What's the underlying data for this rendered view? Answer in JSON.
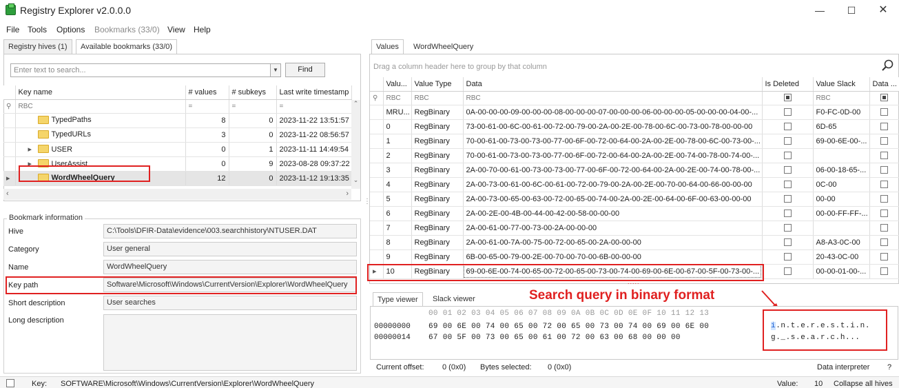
{
  "window": {
    "title": "Registry Explorer v2.0.0.0"
  },
  "menu": [
    "File",
    "Tools",
    "Options",
    "Bookmarks (33/0)",
    "View",
    "Help"
  ],
  "left_tabs": [
    "Registry hives (1)",
    "Available bookmarks (33/0)"
  ],
  "search": {
    "placeholder": "Enter text to search...",
    "find_label": "Find"
  },
  "keys_table": {
    "headers": [
      "Key name",
      "# values",
      "# subkeys",
      "Last write timestamp"
    ],
    "filter_icons": [
      "RBC",
      "=",
      "=",
      "="
    ],
    "rows": [
      {
        "name": "TypedPaths",
        "values": "8",
        "subkeys": "0",
        "ts": "2023-11-22 13:51:57",
        "expand": ""
      },
      {
        "name": "TypedURLs",
        "values": "3",
        "subkeys": "0",
        "ts": "2023-11-22 08:56:57",
        "expand": ""
      },
      {
        "name": "USER",
        "values": "0",
        "subkeys": "1",
        "ts": "2023-11-11 14:49:54",
        "expand": "▸"
      },
      {
        "name": "UserAssist",
        "values": "0",
        "subkeys": "9",
        "ts": "2023-08-28 09:37:22",
        "expand": "▸"
      },
      {
        "name": "WordWheelQuery",
        "values": "12",
        "subkeys": "0",
        "ts": "2023-11-12 19:13:35",
        "expand": ""
      }
    ]
  },
  "bookmark_info": {
    "title": "Bookmark information",
    "hive_label": "Hive",
    "hive": "C:\\Tools\\DFIR-Data\\evidence\\003.searchhistory\\NTUSER.DAT",
    "category_label": "Category",
    "category": "User general",
    "name_label": "Name",
    "name": "WordWheelQuery",
    "keypath_label": "Key path",
    "keypath": "Software\\Microsoft\\Windows\\CurrentVersion\\Explorer\\WordWheelQuery",
    "shortdesc_label": "Short description",
    "shortdesc": "User searches",
    "longdesc_label": "Long description"
  },
  "right_tabs": [
    "Values",
    "WordWheelQuery"
  ],
  "group_hint": "Drag a column header here to group by that column",
  "values_table": {
    "headers": [
      "Valu...",
      "Value Type",
      "Data",
      "Is Deleted",
      "Value Slack",
      "Data ..."
    ],
    "rows": [
      {
        "n": "MRU...",
        "t": "RegBinary",
        "d": "0A-00-00-00-09-00-00-00-08-00-00-00-07-00-00-00-06-00-00-00-05-00-00-00-04-00-...",
        "s": "F0-FC-0D-00"
      },
      {
        "n": "0",
        "t": "RegBinary",
        "d": "73-00-61-00-6C-00-61-00-72-00-79-00-2A-00-2E-00-78-00-6C-00-73-00-78-00-00-00",
        "s": "6D-65"
      },
      {
        "n": "1",
        "t": "RegBinary",
        "d": "70-00-61-00-73-00-73-00-77-00-6F-00-72-00-64-00-2A-00-2E-00-78-00-6C-00-73-00-...",
        "s": "69-00-6E-00-..."
      },
      {
        "n": "2",
        "t": "RegBinary",
        "d": "70-00-61-00-73-00-73-00-77-00-6F-00-72-00-64-00-2A-00-2E-00-74-00-78-00-74-00-...",
        "s": ""
      },
      {
        "n": "3",
        "t": "RegBinary",
        "d": "2A-00-70-00-61-00-73-00-73-00-77-00-6F-00-72-00-64-00-2A-00-2E-00-74-00-78-00-...",
        "s": "06-00-18-65-..."
      },
      {
        "n": "4",
        "t": "RegBinary",
        "d": "2A-00-73-00-61-00-6C-00-61-00-72-00-79-00-2A-00-2E-00-70-00-64-00-66-00-00-00",
        "s": "0C-00"
      },
      {
        "n": "5",
        "t": "RegBinary",
        "d": "2A-00-73-00-65-00-63-00-72-00-65-00-74-00-2A-00-2E-00-64-00-6F-00-63-00-00-00",
        "s": "00-00"
      },
      {
        "n": "6",
        "t": "RegBinary",
        "d": "2A-00-2E-00-4B-00-44-00-42-00-58-00-00-00",
        "s": "00-00-FF-FF-..."
      },
      {
        "n": "7",
        "t": "RegBinary",
        "d": "2A-00-61-00-77-00-73-00-2A-00-00-00",
        "s": ""
      },
      {
        "n": "8",
        "t": "RegBinary",
        "d": "2A-00-61-00-7A-00-75-00-72-00-65-00-2A-00-00-00",
        "s": "A8-A3-0C-00"
      },
      {
        "n": "9",
        "t": "RegBinary",
        "d": "6B-00-65-00-79-00-2E-00-70-00-70-00-6B-00-00-00",
        "s": "20-43-0C-00"
      },
      {
        "n": "10",
        "t": "RegBinary",
        "d": "69-00-6E-00-74-00-65-00-72-00-65-00-73-00-74-00-69-00-6E-00-67-00-5F-00-73-00-...",
        "s": "00-00-01-00-..."
      }
    ]
  },
  "viewer_tabs": [
    "Type viewer",
    "Slack viewer"
  ],
  "annotation": "Search query in binary format",
  "hex": {
    "header": "00 01 02 03 04 05 06 07 08 09 0A 0B 0C 0D 0E 0F 10 11 12 13",
    "rows": [
      {
        "offset": "00000000",
        "bytes": "69 00 6E 00 74 00 65 00 72 00 65 00 73 00 74 00 69 00 6E 00"
      },
      {
        "offset": "00000014",
        "bytes": "67 00 5F 00 73 00 65 00 61 00 72 00 63 00 68 00 00 00"
      }
    ],
    "ascii": [
      ".n.t.e.r.e.s.t.i.n.",
      "g._.s.e.a.r.c.h..."
    ],
    "ascii_cursor": "i"
  },
  "hex_status": {
    "offset_label": "Current offset:",
    "offset": "0 (0x0)",
    "bytes_label": "Bytes selected:",
    "bytes": "0 (0x0)",
    "interp": "Data interpreter",
    "help": "?"
  },
  "statusbar": {
    "key_label": "Key:",
    "key": "SOFTWARE\\Microsoft\\Windows\\CurrentVersion\\Explorer\\WordWheelQuery",
    "value_label": "Value:",
    "value": "10",
    "collapse": "Collapse all hives"
  }
}
